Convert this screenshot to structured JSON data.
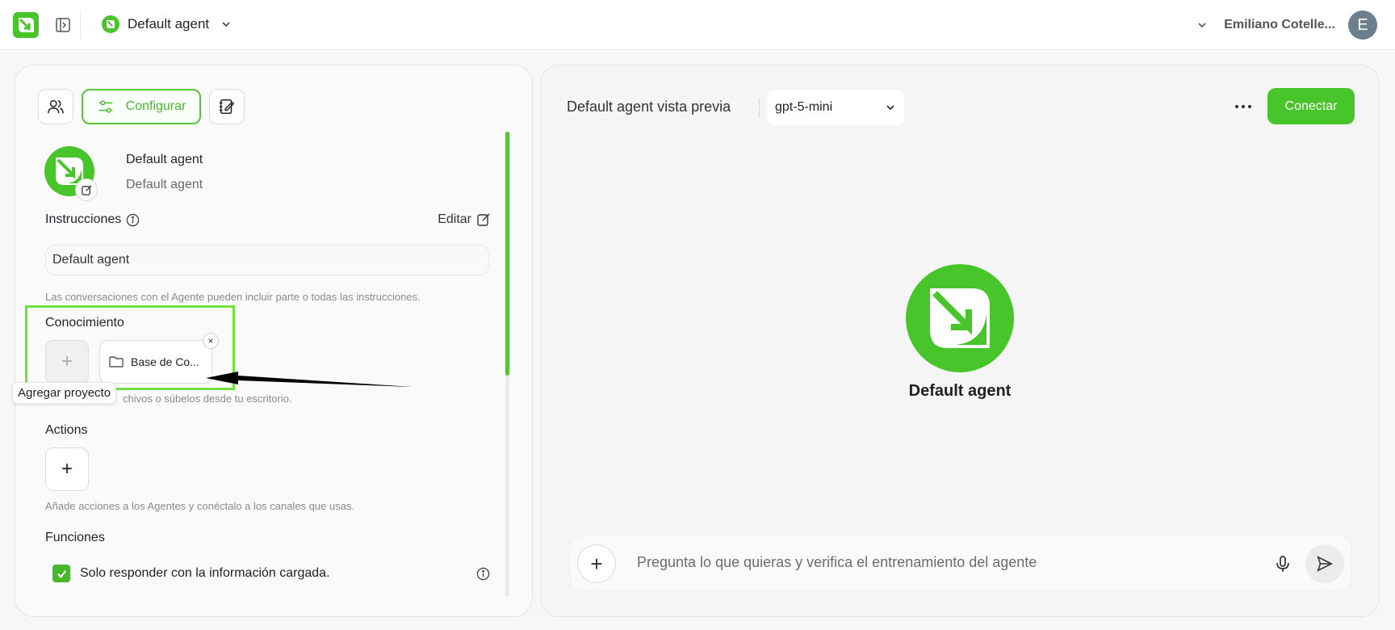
{
  "topbar": {
    "agent_name": "Default agent",
    "user_name": "Emiliano Cotelle...",
    "user_initial": "E"
  },
  "left": {
    "tab_configure": "Configurar",
    "agent_title": "Default agent",
    "agent_subtitle": "Default agent",
    "instructions_label": "Instrucciones",
    "edit_label": "Editar",
    "instructions_value": "Default agent",
    "instructions_hint": "Las conversaciones con el Agente pueden incluir parte o todas las instrucciones.",
    "knowledge_label": "Conocimiento",
    "add_symbol": "+",
    "kb_chip_label": "Base de Co...",
    "chip_close": "×",
    "tooltip": "Agregar proyecto",
    "knowledge_hint_visible": "chivos o súbelos desde tu escritorio.",
    "actions_label": "Actions",
    "actions_hint": "Añade acciones a los Agentes y conéctalo a los canales que usas.",
    "functions_label": "Funciones",
    "only_loaded_label": "Solo responder con la información cargada.",
    "only_loaded_checked": true
  },
  "right": {
    "preview_title": "Default agent vista previa",
    "model_value": "gpt-5-mini",
    "more_label": "•••",
    "connect_label": "Conectar",
    "center_name": "Default agent",
    "chat_placeholder": "Pregunta lo que quieras y verifica el entrenamiento del agente",
    "chat_plus": "+"
  },
  "colors": {
    "accent": "#49b72c",
    "highlight_frame": "#6fe33c"
  },
  "icons": [
    "app-logo-icon",
    "sidebar-toggle-icon",
    "chevron-down-icon",
    "users-icon",
    "sliders-icon",
    "notebook-edit-icon",
    "edit-icon",
    "info-icon",
    "folder-icon",
    "close-icon",
    "more-icon",
    "mic-icon",
    "send-icon",
    "check-icon"
  ]
}
